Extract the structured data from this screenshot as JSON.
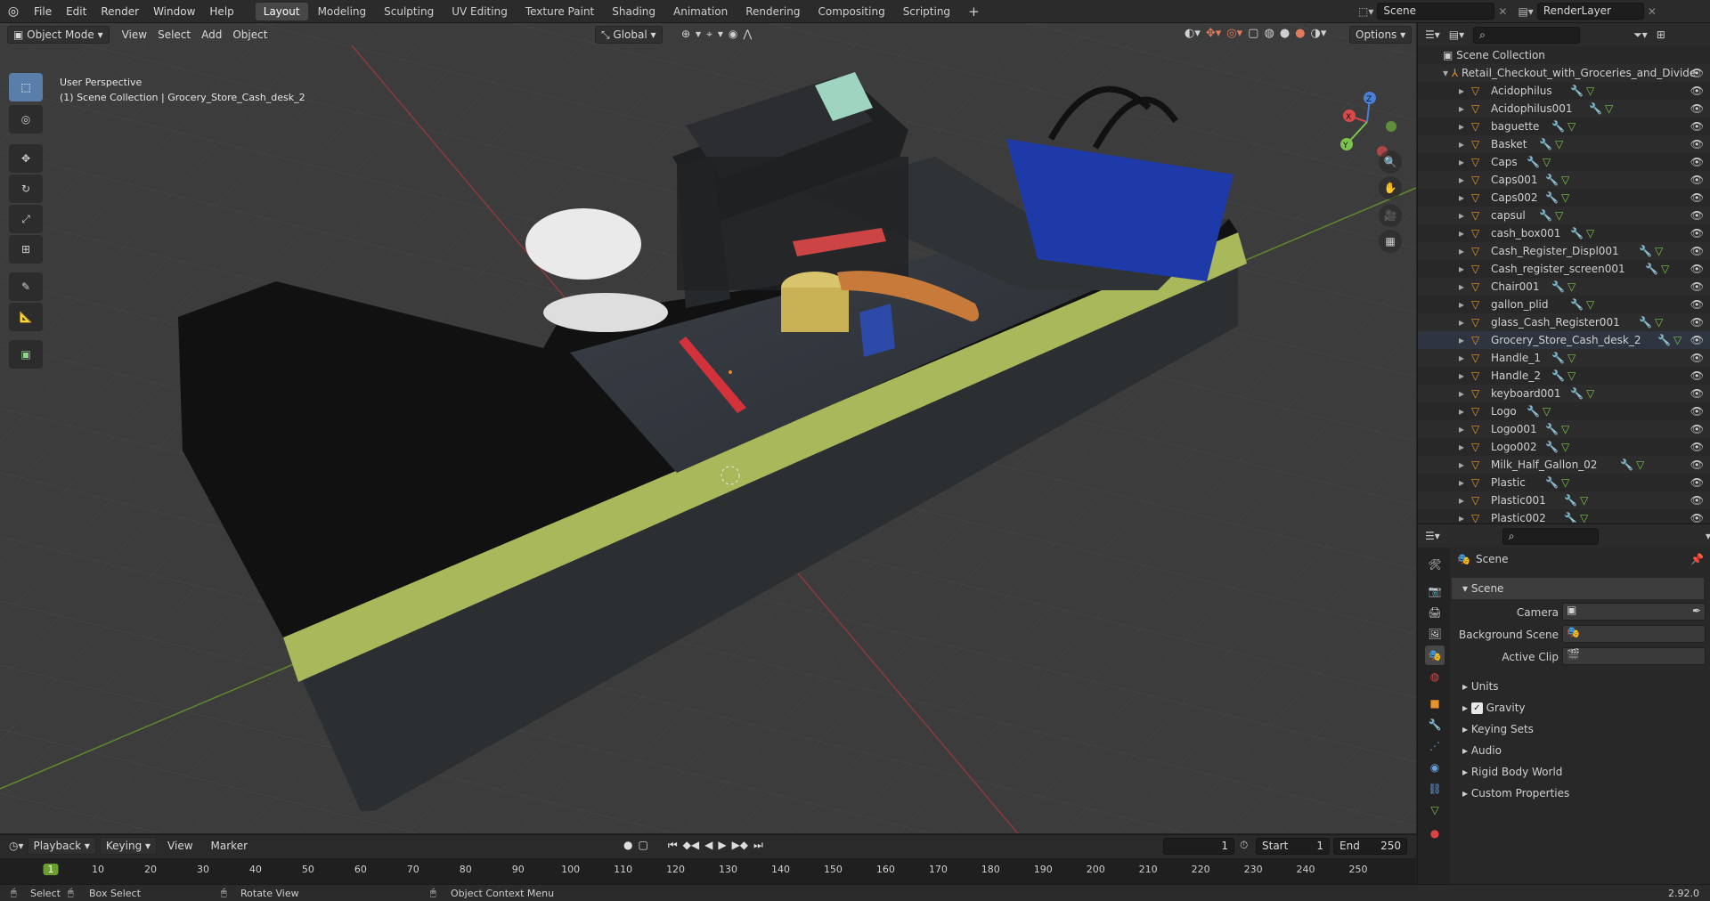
{
  "topbar": {
    "menus": [
      "File",
      "Edit",
      "Render",
      "Window",
      "Help"
    ],
    "workspaces": [
      "Layout",
      "Modeling",
      "Sculpting",
      "UV Editing",
      "Texture Paint",
      "Shading",
      "Animation",
      "Rendering",
      "Compositing",
      "Scripting"
    ],
    "active_workspace": "Layout",
    "add_tab": "+",
    "scene_name": "Scene",
    "view_layer": "RenderLayer"
  },
  "viewport": {
    "mode": "Object Mode",
    "menus": [
      "View",
      "Select",
      "Add",
      "Object"
    ],
    "orientation": "Global",
    "options": "Options",
    "perspective_label": "User Perspective",
    "context_label": "(1) Scene Collection | Grocery_Store_Cash_desk_2",
    "axis_labels": {
      "x": "X",
      "y": "Y",
      "z": "Z"
    }
  },
  "toolbar": {
    "tools": [
      "select-box-icon",
      "cursor-icon",
      "move-icon",
      "rotate-icon",
      "scale-icon",
      "transform-icon",
      "annotate-icon",
      "measure-icon",
      "add-cube-icon"
    ]
  },
  "outliner": {
    "root": "Scene Collection",
    "collection": "Retail_Checkout_with_Groceries_and_Divide",
    "items": [
      "Acidophilus",
      "Acidophilus001",
      "baguette",
      "Basket",
      "Caps",
      "Caps001",
      "Caps002",
      "capsul",
      "cash_box001",
      "Cash_Register_Displ001",
      "Cash_register_screen001",
      "Chair001",
      "gallon_plid",
      "glass_Cash_Register001",
      "Grocery_Store_Cash_desk_2",
      "Handle_1",
      "Handle_2",
      "keyboard001",
      "Logo",
      "Logo001",
      "Logo002",
      "Milk_Half_Gallon_02",
      "Plastic",
      "Plastic001",
      "Plastic002"
    ],
    "selected": "Grocery_Store_Cash_desk_2"
  },
  "properties": {
    "header": "Scene",
    "panel_title": "Scene",
    "camera_label": "Camera",
    "background_scene_label": "Background Scene",
    "active_clip_label": "Active Clip",
    "sections": [
      "Units",
      "Gravity",
      "Keying Sets",
      "Audio",
      "Rigid Body World",
      "Custom Properties"
    ],
    "gravity_checked": true
  },
  "timeline": {
    "menus": [
      "Playback",
      "Keying",
      "View",
      "Marker"
    ],
    "current_frame": "1",
    "start_label": "Start",
    "start": "1",
    "end_label": "End",
    "end": "250",
    "ruler": [
      "1",
      "10",
      "20",
      "30",
      "40",
      "50",
      "60",
      "70",
      "80",
      "90",
      "100",
      "110",
      "120",
      "130",
      "140",
      "150",
      "160",
      "170",
      "180",
      "190",
      "200",
      "210",
      "220",
      "230",
      "240",
      "250"
    ]
  },
  "statusbar": {
    "select": "Select",
    "box_select": "Box Select",
    "rotate_view": "Rotate View",
    "context_menu": "Object Context Menu",
    "version": "2.92.0"
  },
  "colors": {
    "accent": "#5a7eaa",
    "active_frame": "#6a9e2e",
    "orange_object": "#e8922b",
    "desk_stripe": "#a8b85a"
  }
}
